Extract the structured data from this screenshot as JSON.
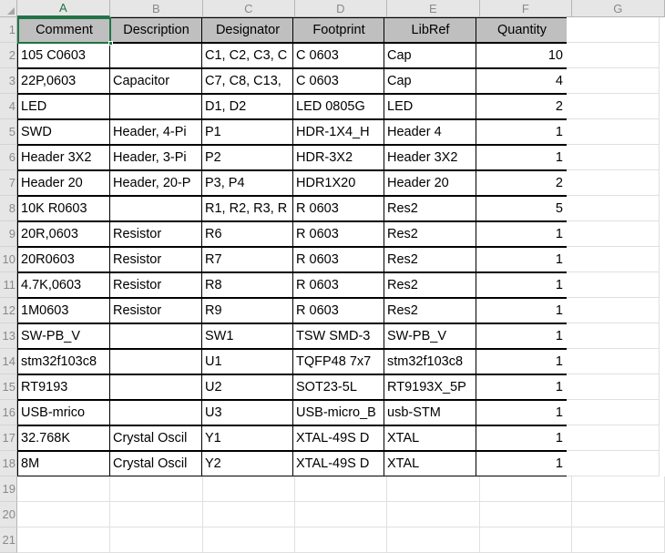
{
  "app": {
    "type": "spreadsheet",
    "accent_color": "#217346",
    "header_fill": "#bfbfbf",
    "gutter_fill": "#e6e6e6"
  },
  "corner": {
    "name": "select-all-button"
  },
  "columns": {
    "letters": [
      "A",
      "B",
      "C",
      "D",
      "E",
      "F",
      "G"
    ],
    "widths": [
      102,
      102,
      101,
      101,
      102,
      101,
      102
    ],
    "selected_letter": "A"
  },
  "rows": {
    "numbers": [
      "1",
      "2",
      "3",
      "4",
      "5",
      "6",
      "7",
      "8",
      "9",
      "10",
      "11",
      "12",
      "13",
      "14",
      "15",
      "16",
      "17",
      "18",
      "19",
      "20",
      "21"
    ],
    "height": 28
  },
  "active_cell": {
    "ref": "A1",
    "value": "Comment"
  },
  "table": {
    "headers": [
      "Comment",
      "Description",
      "Designator",
      "Footprint",
      "LibRef",
      "Quantity"
    ],
    "rows": [
      [
        "105 C0603",
        "",
        "C1, C2, C3, C",
        "C 0603",
        "Cap",
        "10"
      ],
      [
        "22P,0603",
        "Capacitor",
        "C7, C8, C13, ",
        "C 0603",
        "Cap",
        "4"
      ],
      [
        "LED",
        "",
        "D1, D2",
        "LED 0805G",
        "LED",
        "2"
      ],
      [
        "SWD",
        "Header, 4-Pi",
        "P1",
        "HDR-1X4_H",
        "Header 4",
        "1"
      ],
      [
        "Header 3X2",
        "Header, 3-Pi",
        "P2",
        "HDR-3X2",
        "Header 3X2",
        "1"
      ],
      [
        "Header 20",
        "Header, 20-P",
        "P3, P4",
        "HDR1X20",
        "Header 20",
        "2"
      ],
      [
        "10K R0603",
        "",
        "R1, R2, R3, R",
        "R 0603",
        "Res2",
        "5"
      ],
      [
        "20R,0603",
        "Resistor",
        "R6",
        "R 0603",
        "Res2",
        "1"
      ],
      [
        "20R0603",
        "Resistor",
        "R7",
        "R 0603",
        "Res2",
        "1"
      ],
      [
        "4.7K,0603",
        "Resistor",
        "R8",
        "R 0603",
        "Res2",
        "1"
      ],
      [
        "1M0603",
        "Resistor",
        "R9",
        "R 0603",
        "Res2",
        "1"
      ],
      [
        "SW-PB_V",
        "",
        "SW1",
        "TSW SMD-3",
        "SW-PB_V",
        "1"
      ],
      [
        "stm32f103c8",
        "",
        "U1",
        "TQFP48 7x7",
        "stm32f103c8",
        "1"
      ],
      [
        "RT9193",
        "",
        "U2",
        "SOT23-5L",
        "RT9193X_5P",
        "1"
      ],
      [
        "USB-mrico",
        "",
        "U3",
        "USB-micro_B",
        "usb-STM",
        "1"
      ],
      [
        "32.768K",
        "Crystal Oscil",
        "Y1",
        "XTAL-49S D",
        "XTAL",
        "1"
      ],
      [
        "8M",
        "Crystal Oscil",
        "Y2",
        "XTAL-49S D",
        "XTAL",
        "1"
      ]
    ]
  }
}
